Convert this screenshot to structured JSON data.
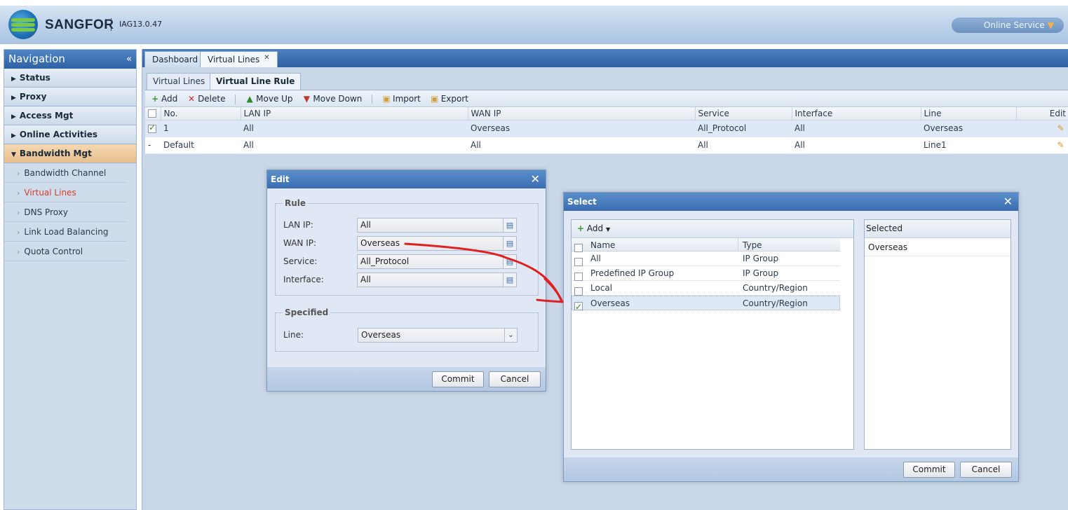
{
  "header": {
    "brand": "SANGFOR",
    "version": "IAG13.0.47",
    "online_service": "Online Service"
  },
  "sidebar": {
    "title": "Navigation",
    "items": [
      {
        "label": "Status"
      },
      {
        "label": "Proxy"
      },
      {
        "label": "Access Mgt"
      },
      {
        "label": "Online Activities"
      },
      {
        "label": "Bandwidth Mgt"
      }
    ],
    "sub_items": [
      {
        "label": "Bandwidth Channel"
      },
      {
        "label": "Virtual Lines"
      },
      {
        "label": "DNS Proxy"
      },
      {
        "label": "Link Load Balancing"
      },
      {
        "label": "Quota Control"
      }
    ]
  },
  "tabs": [
    {
      "label": "Dashboard"
    },
    {
      "label": "Virtual Lines"
    }
  ],
  "subtabs": [
    {
      "label": "Virtual Lines"
    },
    {
      "label": "Virtual Line Rule"
    }
  ],
  "toolbar": {
    "add": "Add",
    "delete": "Delete",
    "move_up": "Move Up",
    "move_down": "Move Down",
    "import": "Import",
    "export": "Export"
  },
  "grid": {
    "columns": [
      "No.",
      "LAN IP",
      "WAN IP",
      "Service",
      "Interface",
      "Line",
      "Edit"
    ],
    "rows": [
      {
        "no": "1",
        "lan_ip": "All",
        "wan_ip": "Overseas",
        "service": "All_Protocol",
        "interface": "All",
        "line": "Overseas"
      },
      {
        "no": "Default",
        "lan_ip": "All",
        "wan_ip": "All",
        "service": "All",
        "interface": "All",
        "line": "Line1"
      }
    ]
  },
  "edit_dialog": {
    "title": "Edit",
    "rule_legend": "Rule",
    "lan_ip_label": "LAN IP:",
    "lan_ip_value": "All",
    "wan_ip_label": "WAN IP:",
    "wan_ip_value": "Overseas",
    "service_label": "Service:",
    "service_value": "All_Protocol",
    "interface_label": "Interface:",
    "interface_value": "All",
    "specified_legend": "Specified",
    "line_label": "Line:",
    "line_value": "Overseas",
    "commit": "Commit",
    "cancel": "Cancel"
  },
  "select_dialog": {
    "title": "Select",
    "add": "Add",
    "columns": [
      "Name",
      "Type"
    ],
    "rows": [
      {
        "name": "All",
        "type": "IP Group"
      },
      {
        "name": "Predefined IP Group",
        "type": "IP Group"
      },
      {
        "name": "Local",
        "type": "Country/Region"
      },
      {
        "name": "Overseas",
        "type": "Country/Region"
      }
    ],
    "selected_header": "Selected",
    "selected_items": [
      "Overseas"
    ],
    "commit": "Commit",
    "cancel": "Cancel"
  },
  "annotation_color": "#e02020"
}
